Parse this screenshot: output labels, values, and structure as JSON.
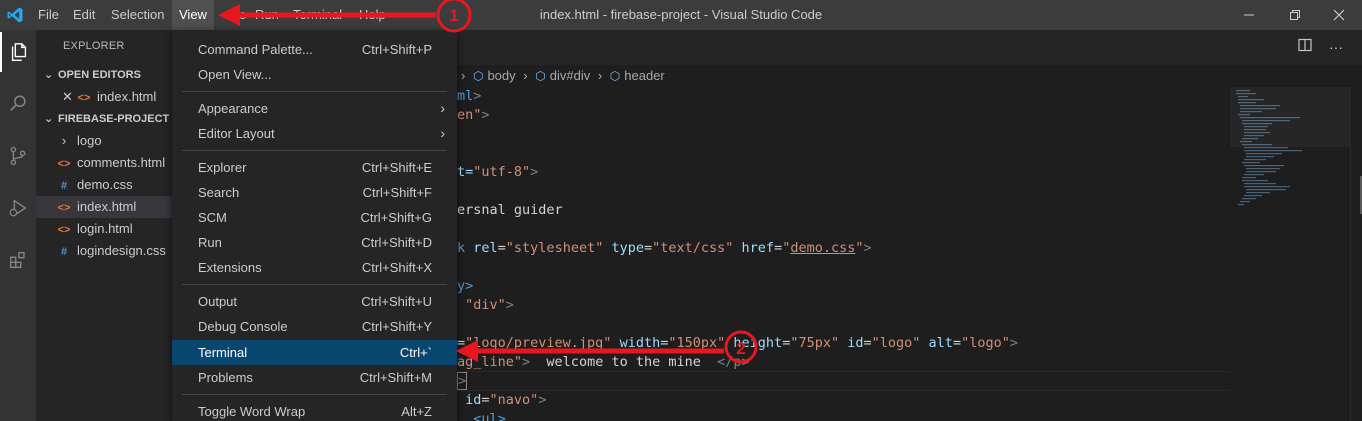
{
  "window": {
    "title": "index.html - firebase-project - Visual Studio Code",
    "controls": [
      "minimize-icon",
      "restore-icon",
      "close-icon"
    ]
  },
  "menubar": {
    "items": [
      "File",
      "Edit",
      "Selection",
      "View",
      "Go",
      "Run",
      "Terminal",
      "Help"
    ],
    "active": "View"
  },
  "activity_bar": {
    "icons": [
      "files-icon",
      "search-icon",
      "source-control-icon",
      "run-debug-icon",
      "extensions-icon"
    ]
  },
  "sidebar": {
    "title": "EXPLORER",
    "open_editors": {
      "label": "OPEN EDITORS",
      "items": [
        {
          "name": "index.html",
          "icon": "html-icon"
        }
      ]
    },
    "project": {
      "label": "FIREBASE-PROJECT",
      "items": [
        {
          "name": "logo",
          "icon": "chevron-right-icon"
        },
        {
          "name": "comments.html",
          "icon": "html-icon"
        },
        {
          "name": "demo.css",
          "icon": "css-icon"
        },
        {
          "name": "index.html",
          "icon": "html-icon",
          "selected": true
        },
        {
          "name": "login.html",
          "icon": "html-icon"
        },
        {
          "name": "logindesign.css",
          "icon": "css-icon"
        }
      ]
    }
  },
  "breadcrumbs": [
    "body",
    "div#div",
    "header"
  ],
  "code_fragments": {
    "l1_a": "ml",
    "l1_b": ">",
    "l2_a": "en\"",
    "l2_b": ">",
    "l3_a": "t=",
    "l3_b": "\"utf-8\"",
    "l3_c": ">",
    "l4": "ersnal guider",
    "l5_a": "k",
    "l5_b": " rel",
    "l5_c": "=",
    "l5_d": "\"stylesheet\"",
    "l5_e": " type",
    "l5_f": "=",
    "l5_g": "\"text/css\"",
    "l5_h": " href",
    "l5_i": "=",
    "l5_j": "\"",
    "l5_k": "demo.css",
    "l5_l": "\"",
    "l5_m": ">",
    "l6": "y>",
    "l7_a": " \"div\"",
    "l7_b": ">",
    "l8_a": "=",
    "l8_b": "\"logo/preview.jpg\"",
    "l8_c": " width",
    "l8_d": "=",
    "l8_e": "\"150px\"",
    "l8_f": " height",
    "l8_g": "=",
    "l8_h": "\"75px\"",
    "l8_i": " id",
    "l8_j": "=",
    "l8_k": "\"logo\"",
    "l8_l": " alt",
    "l8_m": "=",
    "l8_n": "\"logo\"",
    "l8_o": ">",
    "l9_a": "ag_line\"",
    "l9_b": ">",
    "l9_c": "  welcome to the mine  ",
    "l9_d": "</p>",
    "l10": ">",
    "l11_a": " id",
    "l11_b": "=",
    "l11_c": "\"navo\"",
    "l11_d": ">",
    "l12": "  <ul>"
  },
  "view_menu": {
    "groups": [
      [
        {
          "label": "Command Palette...",
          "shortcut": "Ctrl+Shift+P"
        },
        {
          "label": "Open View...",
          "shortcut": ""
        }
      ],
      [
        {
          "label": "Appearance",
          "submenu": true
        },
        {
          "label": "Editor Layout",
          "submenu": true
        }
      ],
      [
        {
          "label": "Explorer",
          "shortcut": "Ctrl+Shift+E"
        },
        {
          "label": "Search",
          "shortcut": "Ctrl+Shift+F"
        },
        {
          "label": "SCM",
          "shortcut": "Ctrl+Shift+G"
        },
        {
          "label": "Run",
          "shortcut": "Ctrl+Shift+D"
        },
        {
          "label": "Extensions",
          "shortcut": "Ctrl+Shift+X"
        }
      ],
      [
        {
          "label": "Output",
          "shortcut": "Ctrl+Shift+U"
        },
        {
          "label": "Debug Console",
          "shortcut": "Ctrl+Shift+Y"
        },
        {
          "label": "Terminal",
          "shortcut": "Ctrl+`",
          "highlighted": true
        },
        {
          "label": "Problems",
          "shortcut": "Ctrl+Shift+M"
        }
      ],
      [
        {
          "label": "Toggle Word Wrap",
          "shortcut": "Alt+Z"
        }
      ]
    ]
  },
  "annotations": {
    "step1": "1",
    "step2": "2",
    "color": "#e8171f"
  },
  "colors": {
    "accent_blue": "#007acc",
    "menu_highlight": "#094771",
    "titlebar": "#3c3c3c"
  }
}
